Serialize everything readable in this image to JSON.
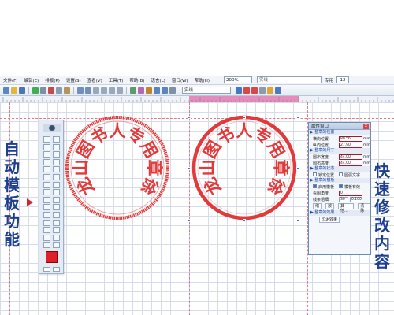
{
  "menubar": {
    "items": [
      "文件(F)",
      "编辑(E)",
      "排版(P)",
      "设置(S)",
      "查看(V)",
      "工具(T)",
      "帮助(B)",
      "语言(L)",
      "窗口(W)",
      "帮助(H)"
    ],
    "zoom": "200%",
    "line_style": "实线",
    "pro_label": "专用",
    "size_value": "12"
  },
  "toolbar": {
    "line_style": "实线"
  },
  "captions": {
    "left": "自动模板功能",
    "right": "快速修改内容"
  },
  "seal_left": {
    "characters": [
      "龙",
      "山",
      "图",
      "书",
      "人",
      "专",
      "用",
      "章",
      "徐"
    ]
  },
  "seal_right": {
    "characters": [
      "龙",
      "山",
      "图",
      "书",
      "人",
      "专",
      "用",
      "章",
      "徐"
    ]
  },
  "properties": {
    "title": "属性窗口",
    "close": "x",
    "section_position": "▶ 整章的位置",
    "x_label": "横向位置:",
    "x_value": "89.56",
    "x_unit": "mm",
    "y_label": "纵向位置:",
    "y_value": "27.90",
    "y_unit": "mm",
    "section_size": "▶ 整章的尺寸",
    "w_label": "圆布宽度:",
    "w_value": "44.00",
    "w_unit": "mm",
    "h_label": "圆布高度:",
    "h_value": "44.00",
    "h_unit": "mm",
    "section_status": "▶ 整章的状态",
    "lock_label": "锁定位置",
    "circle_text_label": "圆弧文字",
    "section_template": "▶ 整章的模板",
    "apply_label": "启用模板",
    "template_label": "模板有效",
    "angle_label": "看图角度:",
    "angle_value": "0",
    "thickness_label": "线条粗细:",
    "thickness_value": "30",
    "thickness_extra": "0.100",
    "btn_shrink": "缩",
    "btn_enlarge": "放",
    "btn_other": "其他...",
    "btn_clear": "清除",
    "section_effect": "▶ 整章的效果",
    "btn_effect": "印泥效果"
  },
  "colors": {
    "seal_red": "#e23a3a",
    "caption_blue": "#1d3f8f",
    "arrow_red": "#d8222b"
  }
}
